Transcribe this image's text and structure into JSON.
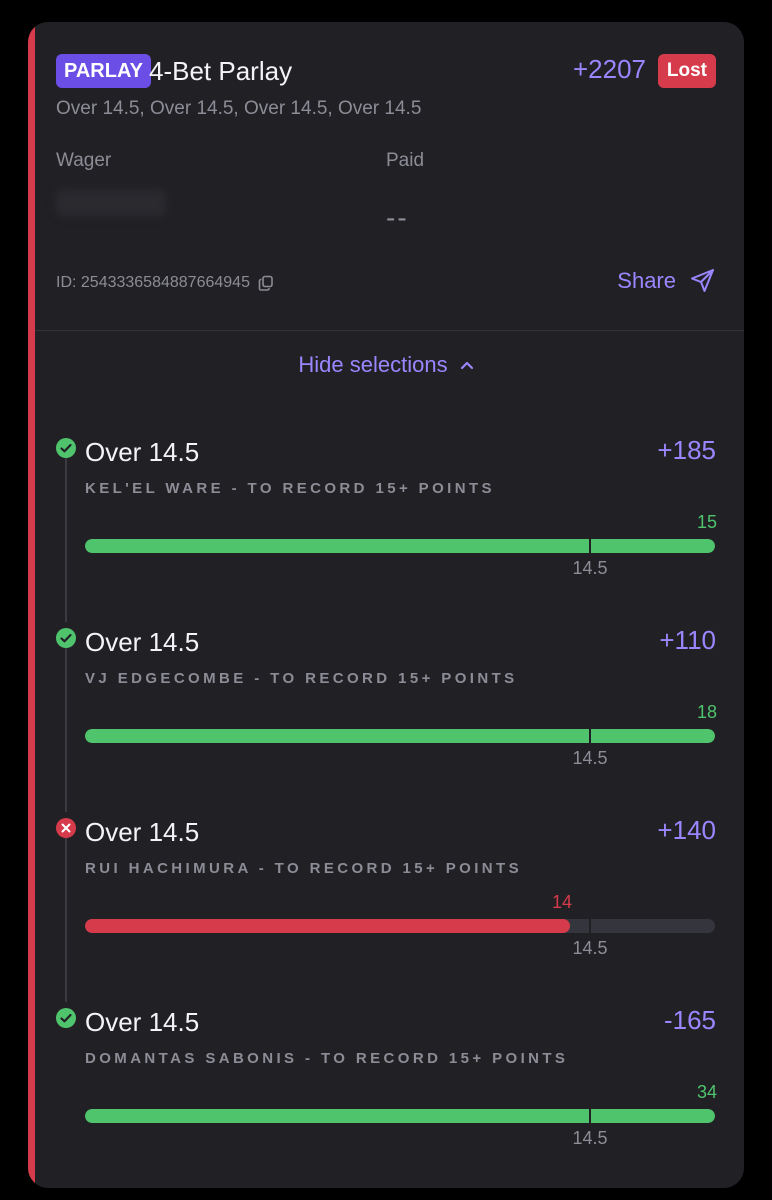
{
  "bet": {
    "type_badge": "PARLAY",
    "title": "4-Bet Parlay",
    "odds": "+2207",
    "status": "Lost",
    "subtitle": "Over 14.5, Over 14.5, Over 14.5, Over 14.5",
    "wager_label": "Wager",
    "paid_label": "Paid",
    "paid_value": "--",
    "id_text": "ID: 2543336584887664945",
    "share_label": "Share",
    "toggle_label": "Hide selections"
  },
  "colors": {
    "accent": "#9a86ff",
    "won": "#4fc46d",
    "lost": "#d53b4b",
    "track": "#35353d"
  },
  "legs": [
    {
      "title": "Over 14.5",
      "odds": "+185",
      "market": "KEL'EL WARE - TO RECORD 15+ POINTS",
      "result": "won",
      "actual": "15",
      "line": "14.5",
      "progress": 1.0
    },
    {
      "title": "Over 14.5",
      "odds": "+110",
      "market": "VJ EDGECOMBE - TO RECORD 15+ POINTS",
      "result": "won",
      "actual": "18",
      "line": "14.5",
      "progress": 1.0
    },
    {
      "title": "Over 14.5",
      "odds": "+140",
      "market": "RUI HACHIMURA - TO RECORD 15+ POINTS",
      "result": "lost",
      "actual": "14",
      "line": "14.5",
      "progress": 0.77
    },
    {
      "title": "Over 14.5",
      "odds": "-165",
      "market": "DOMANTAS SABONIS - TO RECORD 15+ POINTS",
      "result": "won",
      "actual": "34",
      "line": "14.5",
      "progress": 1.0
    }
  ]
}
